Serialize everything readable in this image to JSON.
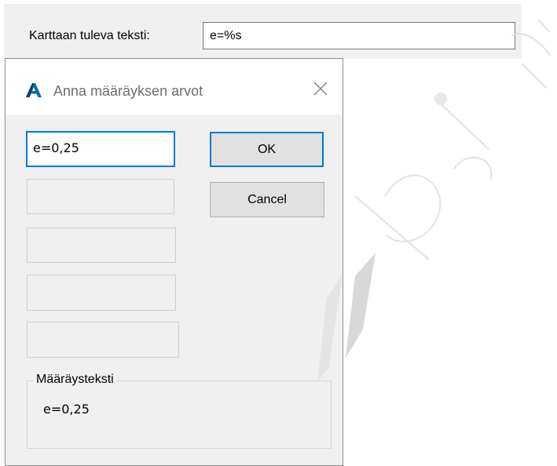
{
  "top_form": {
    "label": "Karttaan tuleva teksti:",
    "value": "e=%s"
  },
  "dialog": {
    "app_icon": "autocad-a-icon",
    "title": "Anna määräyksen arvot",
    "close_icon": "close-x-icon",
    "fields": [
      {
        "value": "e=0,25",
        "focused": true
      },
      {
        "value": "",
        "focused": false
      },
      {
        "value": "",
        "focused": false
      },
      {
        "value": "",
        "focused": false
      },
      {
        "value": "",
        "focused": false
      }
    ],
    "ok_label": "OK",
    "cancel_label": "Cancel",
    "result_group": {
      "label": "Määräysteksti",
      "value": "e=0,25"
    }
  },
  "colors": {
    "accent": "#0078d7",
    "dialog_bg": "#f0f0f0",
    "button_bg": "#e1e1e1"
  }
}
